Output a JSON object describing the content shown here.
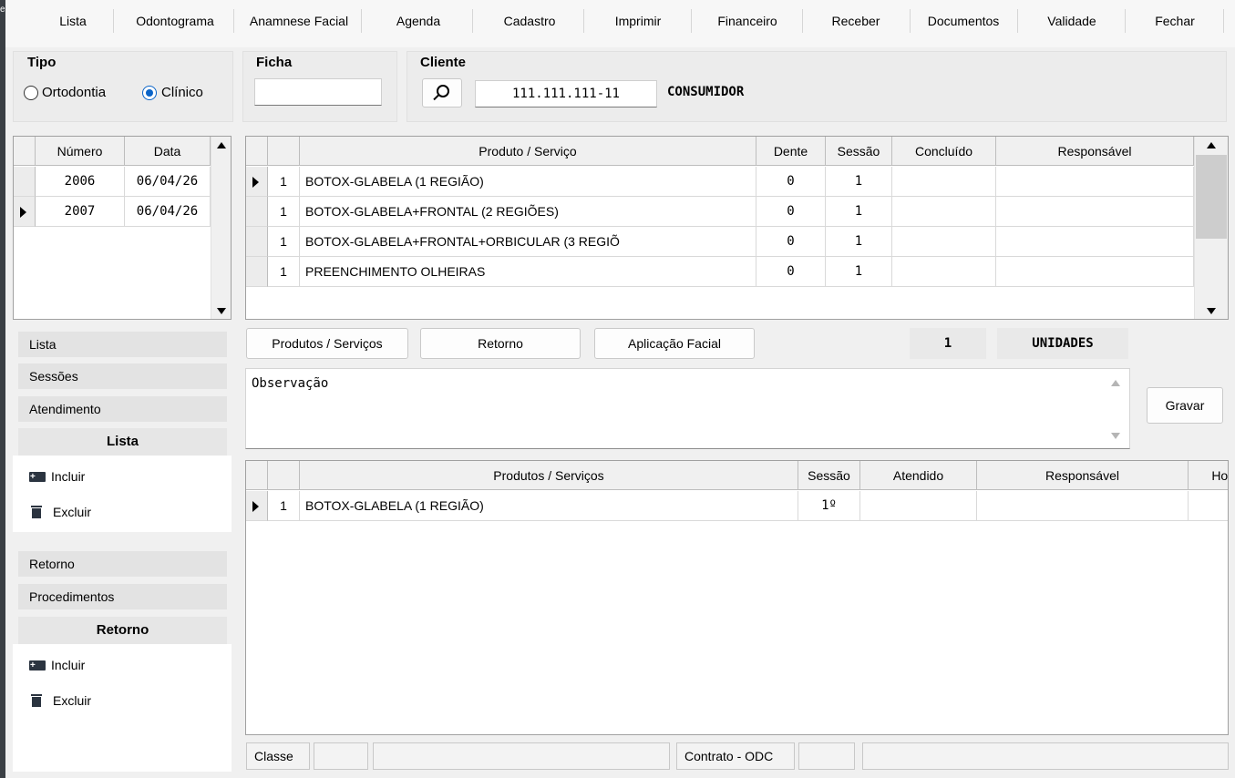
{
  "menu": [
    "Lista",
    "Odontograma",
    "Anamnese Facial",
    "Agenda",
    "Cadastro",
    "Imprimir",
    "Financeiro",
    "Receber",
    "Documentos",
    "Validade",
    "Fechar"
  ],
  "tipo": {
    "label": "Tipo",
    "options": [
      "Ortodontia",
      "Clínico"
    ],
    "selected": "Clínico"
  },
  "ficha": {
    "label": "Ficha",
    "value": ""
  },
  "cliente": {
    "label": "Cliente",
    "cpf": "111.111.111-11",
    "name": "CONSUMIDOR"
  },
  "fichas_grid": {
    "headers": [
      "Número",
      "Data"
    ],
    "rows": [
      {
        "numero": "2006",
        "data": "06/04/26"
      },
      {
        "numero": "2007",
        "data": "06/04/26"
      }
    ]
  },
  "produtos_grid": {
    "headers": [
      "Produto / Serviço",
      "Dente",
      "Sessão",
      "Concluído",
      "Responsável"
    ],
    "rows": [
      {
        "qtd": "1",
        "produto": "BOTOX-GLABELA (1 REGIÃO)",
        "dente": "0",
        "sessao": "1",
        "concluido": "",
        "responsavel": ""
      },
      {
        "qtd": "1",
        "produto": "BOTOX-GLABELA+FRONTAL (2 REGIÕES)",
        "dente": "0",
        "sessao": "1",
        "concluido": "",
        "responsavel": ""
      },
      {
        "qtd": "1",
        "produto": "BOTOX-GLABELA+FRONTAL+ORBICULAR (3 REGIÕ",
        "dente": "0",
        "sessao": "1",
        "concluido": "",
        "responsavel": ""
      },
      {
        "qtd": "1",
        "produto": "PREENCHIMENTO OLHEIRAS",
        "dente": "0",
        "sessao": "1",
        "concluido": "",
        "responsavel": ""
      }
    ]
  },
  "sidebar": {
    "tabs1": [
      "Lista",
      "Sessões",
      "Atendimento"
    ],
    "head1": "Lista",
    "actions1": [
      "Incluir",
      "Excluir"
    ],
    "tabs2": [
      "Retorno",
      "Procedimentos"
    ],
    "head2": "Retorno",
    "actions2": [
      "Incluir",
      "Excluir"
    ]
  },
  "mid_buttons": [
    "Produtos / Serviços",
    "Retorno",
    "Aplicação Facial"
  ],
  "unidades": {
    "count": "1",
    "label": "UNIDADES"
  },
  "observacao": "Observação",
  "gravar": "Gravar",
  "atend_grid": {
    "headers": [
      "Produtos / Serviços",
      "Sessão",
      "Atendido",
      "Responsável",
      "Hora"
    ],
    "rows": [
      {
        "qtd": "1",
        "produto": "BOTOX-GLABELA (1 REGIÃO)",
        "sessao": "1º",
        "atendido": "",
        "responsavel": "",
        "hora": ""
      }
    ]
  },
  "status": {
    "classe": "Classe",
    "contrato": "Contrato - ODC"
  }
}
